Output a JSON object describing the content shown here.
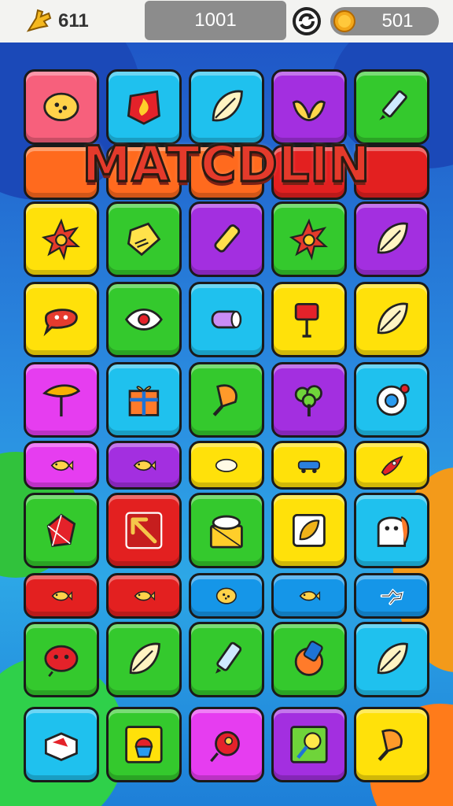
{
  "topbar": {
    "left_icon": "hand-icon",
    "left_value": "611",
    "center_value": "1001",
    "refresh_icon": "refresh-icon",
    "coin_icon": "coin-icon",
    "coin_value": "501"
  },
  "title": "MATCDLIN",
  "colors": {
    "pink": "#f7607c",
    "cyan": "#1fc1ee",
    "purple": "#a32fe0",
    "green": "#34c92d",
    "yellow": "#ffe10a",
    "orange": "#ff6a1e",
    "red": "#e32020",
    "blue": "#1596e8",
    "magenta": "#e63df0"
  },
  "rows": [
    [
      {
        "c": "pink",
        "icon": "cookie-icon"
      },
      {
        "c": "cyan",
        "icon": "flame-badge-icon"
      },
      {
        "c": "cyan",
        "icon": "leaf-icon"
      },
      {
        "c": "purple",
        "icon": "hands-icon"
      },
      {
        "c": "green",
        "icon": "pen-icon"
      }
    ],
    [
      {
        "c": "orange",
        "icon": "banner-tile"
      },
      {
        "c": "orange",
        "icon": "banner-tile"
      },
      {
        "c": "orange",
        "icon": "banner-tile"
      },
      {
        "c": "red",
        "icon": "banner-tile"
      },
      {
        "c": "red",
        "icon": "banner-tile"
      }
    ],
    [
      {
        "c": "yellow",
        "icon": "sun-icon"
      },
      {
        "c": "green",
        "icon": "tag-icon"
      },
      {
        "c": "purple",
        "icon": "crayon-icon"
      },
      {
        "c": "green",
        "icon": "sun-icon"
      },
      {
        "c": "purple",
        "icon": "leaf-icon"
      }
    ],
    [
      {
        "c": "yellow",
        "icon": "chat-bubble-icon"
      },
      {
        "c": "green",
        "icon": "eye-icon"
      },
      {
        "c": "cyan",
        "icon": "candy-icon"
      },
      {
        "c": "yellow",
        "icon": "sign-icon"
      },
      {
        "c": "yellow",
        "icon": "leaf-icon"
      }
    ],
    [
      {
        "c": "magenta",
        "icon": "umbrella-icon"
      },
      {
        "c": "cyan",
        "icon": "gift-icon"
      },
      {
        "c": "green",
        "icon": "popsicle-icon"
      },
      {
        "c": "purple",
        "icon": "tree-icon"
      },
      {
        "c": "cyan",
        "icon": "ring-icon"
      }
    ],
    [
      {
        "c": "magenta",
        "icon": "fish-icon"
      },
      {
        "c": "purple",
        "icon": "fish-icon"
      },
      {
        "c": "yellow",
        "icon": "bean-icon"
      },
      {
        "c": "yellow",
        "icon": "car-icon"
      },
      {
        "c": "yellow",
        "icon": "rocket-icon"
      }
    ],
    [
      {
        "c": "green",
        "icon": "gem-icon"
      },
      {
        "c": "red",
        "icon": "arrow-icon"
      },
      {
        "c": "green",
        "icon": "basket-icon"
      },
      {
        "c": "yellow",
        "icon": "seed-icon"
      },
      {
        "c": "cyan",
        "icon": "ghost-icon"
      }
    ],
    [
      {
        "c": "red",
        "icon": "fish-icon"
      },
      {
        "c": "red",
        "icon": "fish-icon"
      },
      {
        "c": "blue",
        "icon": "cookie-icon"
      },
      {
        "c": "blue",
        "icon": "fish-icon"
      },
      {
        "c": "blue",
        "icon": "dog-icon"
      }
    ],
    [
      {
        "c": "green",
        "icon": "face-icon"
      },
      {
        "c": "green",
        "icon": "leaf-icon"
      },
      {
        "c": "green",
        "icon": "marker-icon"
      },
      {
        "c": "green",
        "icon": "paint-icon"
      },
      {
        "c": "cyan",
        "icon": "leaf-icon"
      }
    ],
    [
      {
        "c": "cyan",
        "icon": "box-icon"
      },
      {
        "c": "green",
        "icon": "cupcake-icon"
      },
      {
        "c": "magenta",
        "icon": "bird-icon"
      },
      {
        "c": "purple",
        "icon": "bulb-icon"
      },
      {
        "c": "yellow",
        "icon": "popsicle-icon"
      }
    ]
  ]
}
